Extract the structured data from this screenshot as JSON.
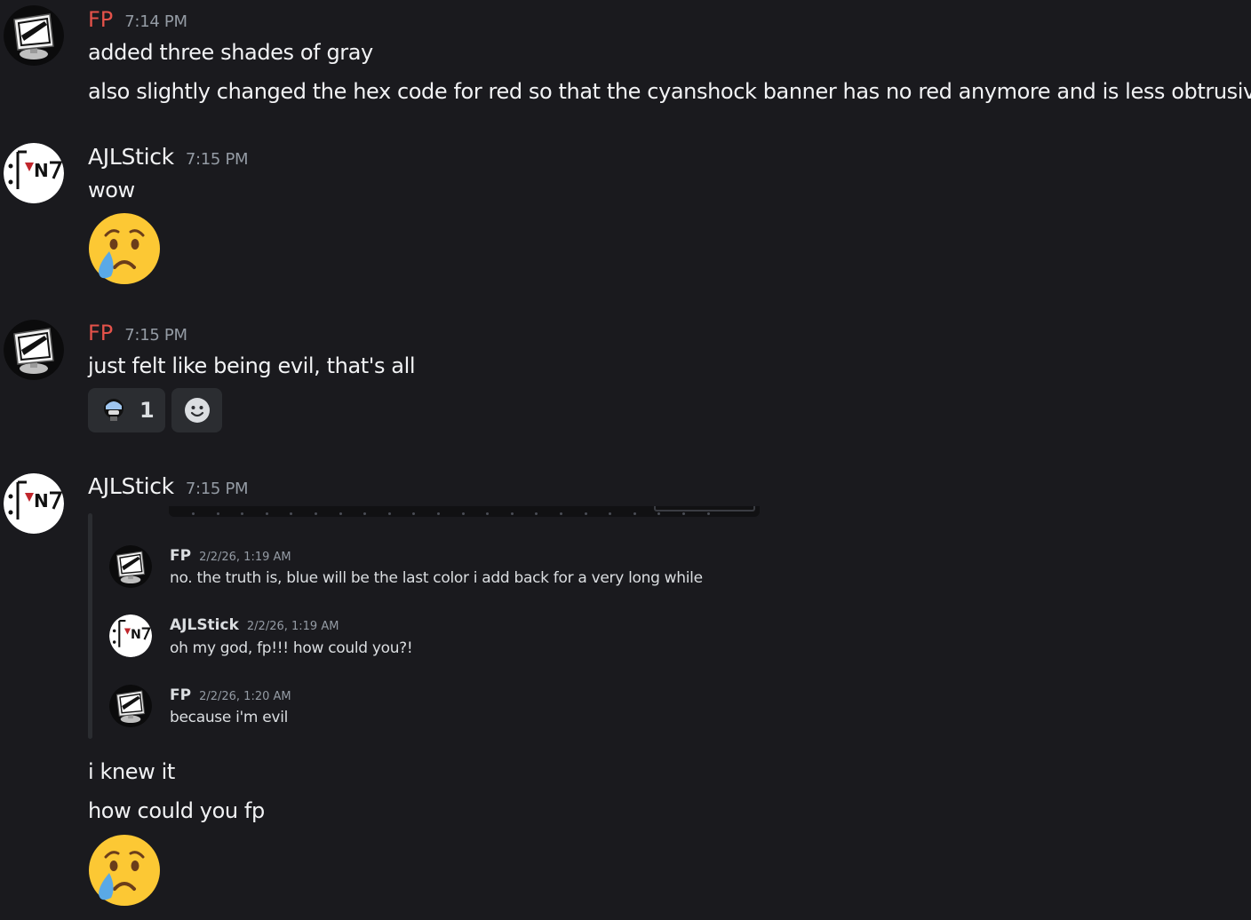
{
  "messages": [
    {
      "author": "FP",
      "time": "7:14 PM",
      "lines": [
        "added three shades of gray",
        "also slightly changed the hex code for red so that the cyanshock banner has no red anymore and is less obtrusive"
      ]
    },
    {
      "author": "AJLStick",
      "time": "7:15 PM",
      "lines": [
        "wow"
      ],
      "emoji": "crying-face"
    },
    {
      "author": "FP",
      "time": "7:15 PM",
      "lines": [
        "just felt like being evil, that's all"
      ],
      "reaction": {
        "emoji": "custom-helmet-emoji",
        "count": "1"
      }
    },
    {
      "author": "AJLStick",
      "time": "7:15 PM",
      "quoted": [
        {
          "author": "FP",
          "time": "2/2/26, 1:19 AM",
          "text": "no. the truth is, blue will be the last color i add back for a very long while"
        },
        {
          "author": "AJLStick",
          "time": "2/2/26, 1:19 AM",
          "text": "oh my god, fp!!! how could you?!"
        },
        {
          "author": "FP",
          "time": "2/2/26, 1:20 AM",
          "text": "because i'm evil"
        }
      ],
      "lines": [
        "i knew it",
        "how could you fp"
      ],
      "emoji": "crying-face"
    }
  ],
  "colors": {
    "background": "#1a1a1e",
    "fp_name": "#e4524a",
    "timestamp": "#949ba4",
    "text": "#f2f3f5"
  }
}
